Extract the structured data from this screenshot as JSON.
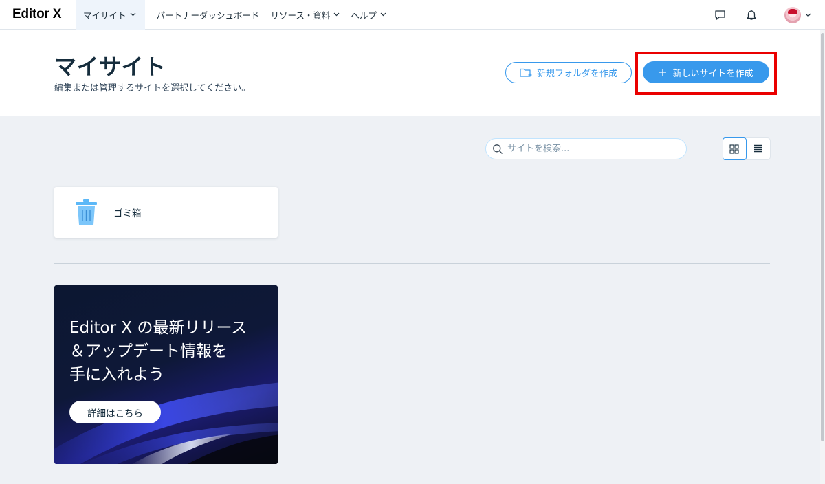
{
  "app": {
    "logo": "Editor X"
  },
  "nav": {
    "items": [
      {
        "label": "マイサイト",
        "icon": "chevron-down-icon",
        "active": true
      },
      {
        "label": "パートナーダッシュボード"
      },
      {
        "label": "リソース・資料",
        "icon": "chevron-down-icon"
      },
      {
        "label": "ヘルプ",
        "icon": "chevron-down-icon"
      }
    ],
    "right_icons": [
      "chat-icon",
      "bell-icon",
      "avatar",
      "chevron-down-icon"
    ]
  },
  "header": {
    "title": "マイサイト",
    "subtitle": "編集または管理するサイトを選択してください。",
    "new_folder_label": "新規フォルダを作成",
    "new_site_label": "新しいサイトを作成",
    "new_site_icon": "plus-icon",
    "new_folder_icon": "folder-plus-icon"
  },
  "toolbar": {
    "search_placeholder": "サイトを検索...",
    "search_icon": "search-icon",
    "view_modes": [
      "grid-view-icon",
      "list-view-icon"
    ],
    "active_view": "grid"
  },
  "trash": {
    "label": "ゴミ箱",
    "icon": "trash-icon"
  },
  "promo": {
    "text": "Editor X の最新リリース\n＆アップデート情報を\n手に入れよう",
    "button_label": "詳細はこちら"
  },
  "colors": {
    "accent": "#3899ec",
    "highlight": "#ea0000",
    "background": "#eef1f5",
    "text": "#162d3d"
  }
}
